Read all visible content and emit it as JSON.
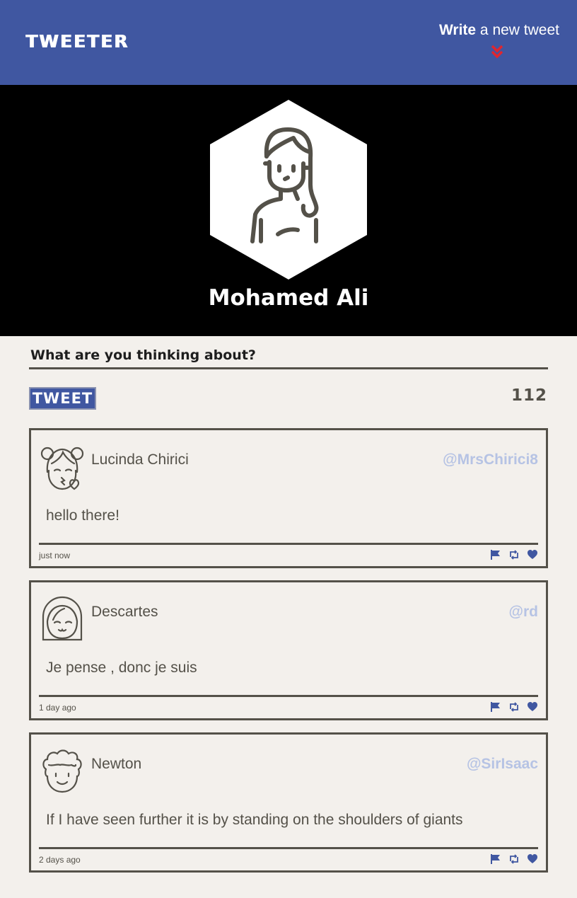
{
  "nav": {
    "brand": "TWEETER",
    "compose_link_bold": "Write",
    "compose_link_rest": " a new tweet",
    "chevron_icon": "double-chevron-down-icon",
    "chevron_color": "#e0262f"
  },
  "profile": {
    "name": "Mohamed Ali",
    "avatar_icon": "woman-avatar-icon"
  },
  "composer": {
    "prompt": "What are you thinking about?",
    "tweet_button": "TWEET",
    "char_counter": "112"
  },
  "colors": {
    "nav_bg": "#4057a1",
    "page_bg": "#f3f0ec",
    "header_bg": "#000000",
    "text": "#545149",
    "handle": "#b6c3e4",
    "action_icons": "#4057a1"
  },
  "tweets": [
    {
      "name": "Lucinda Chirici",
      "handle": "@MrsChirici8",
      "body": "hello there!",
      "time": "just now",
      "avatar_icon": "girl-kiss-avatar-icon"
    },
    {
      "name": "Descartes",
      "handle": "@rd",
      "body": "Je pense , donc je suis",
      "time": "1 day ago",
      "avatar_icon": "girl-smile-avatar-icon"
    },
    {
      "name": "Newton",
      "handle": "@SirIsaac",
      "body": "If I have seen further it is by standing on the shoulders of giants",
      "time": "2 days ago",
      "avatar_icon": "curly-hair-avatar-icon"
    }
  ],
  "tweet_actions": [
    "flag-icon",
    "retweet-icon",
    "heart-icon"
  ]
}
